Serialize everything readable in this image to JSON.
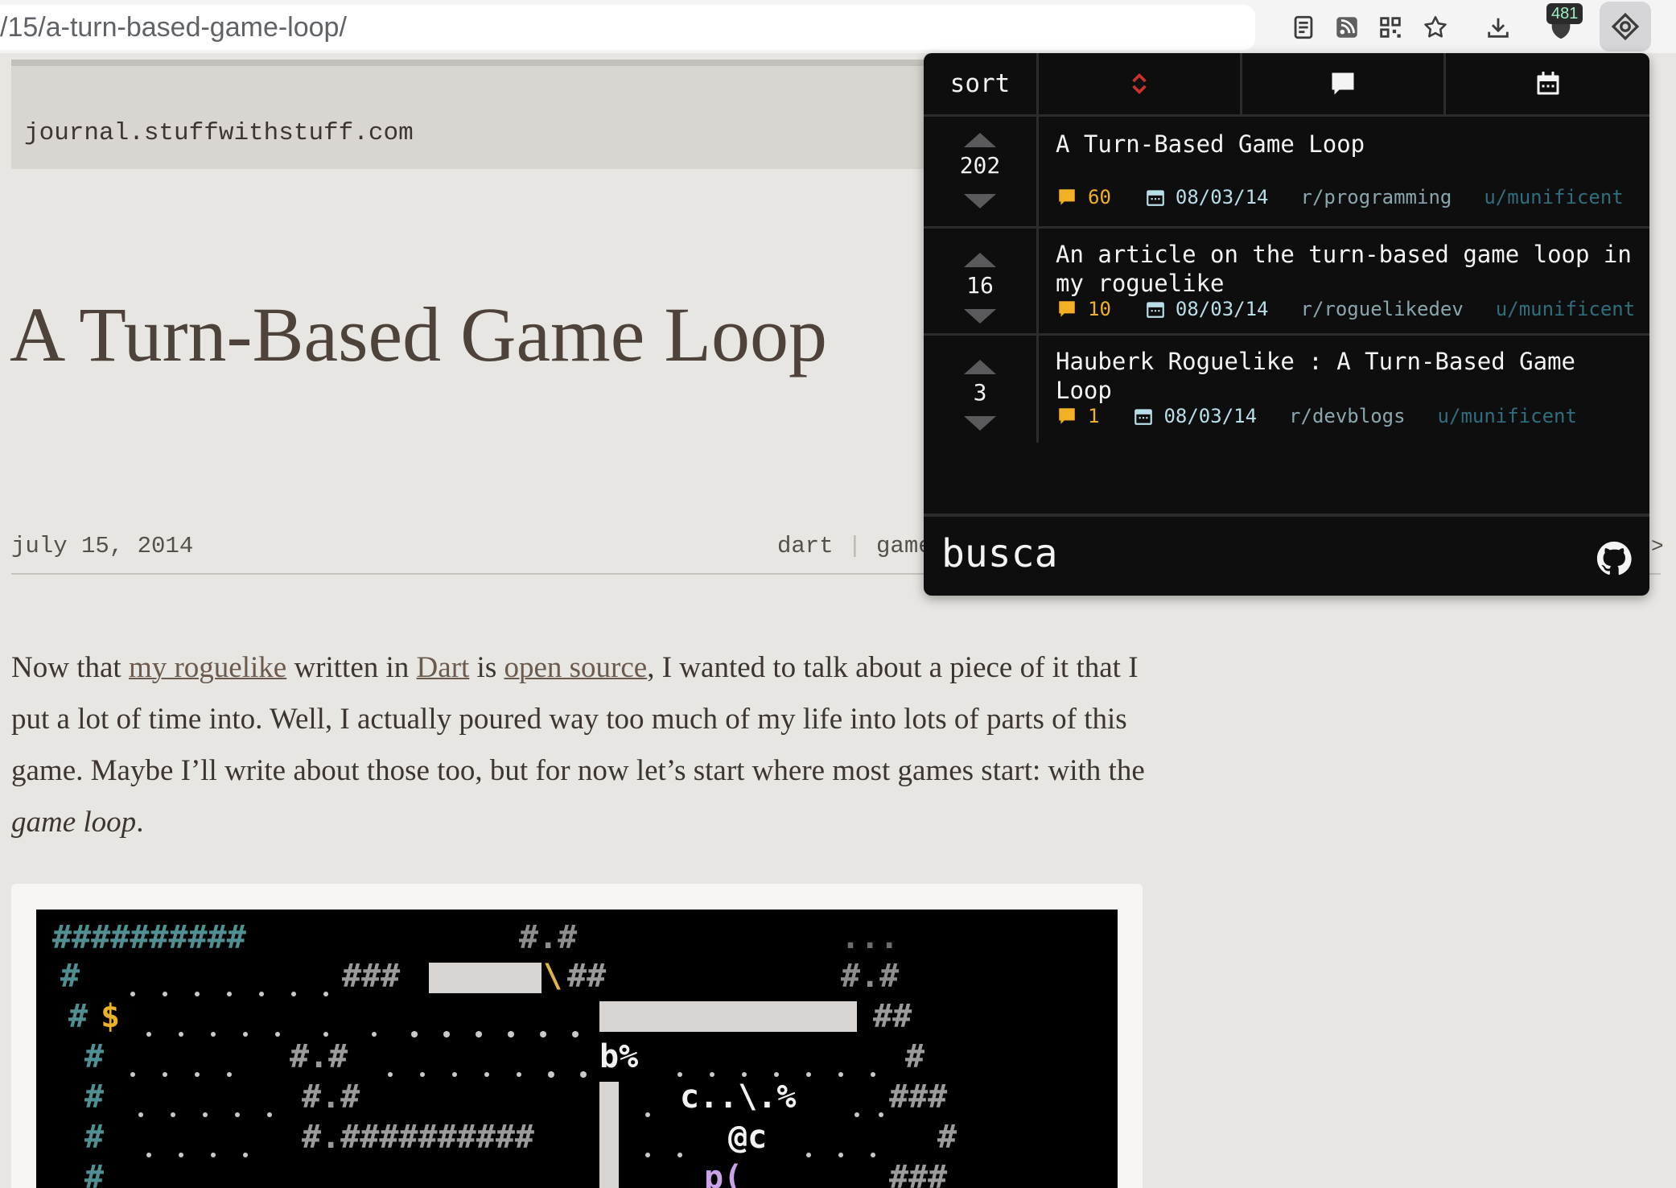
{
  "browser": {
    "url": "/15/a-turn-based-game-loop/",
    "extension_badge": "481"
  },
  "page": {
    "site": "journal.stuffwithstuff.com",
    "title": "A Turn-Based Game Loop",
    "date": "july 15, 2014",
    "tags": [
      "dart",
      "game"
    ],
    "intro": {
      "t1": "Now that ",
      "link1": "my roguelike",
      "t2": " written in ",
      "link2": "Dart",
      "t3": " is ",
      "link3": "open source",
      "t4": ", I wanted to talk about a piece of it that I put a lot of time into. Well, I actually poured way too much of my life into lots of parts of this game. Maybe I’ll write about those too, but for now let’s start where most games start: with the ",
      "em": "game loop",
      "t5": "."
    }
  },
  "popup": {
    "sort_label": "sort",
    "icons": [
      "sort-arrows-icon",
      "comment-icon",
      "calendar-icon"
    ],
    "results": [
      {
        "score": "202",
        "title": "A Turn-Based Game Loop",
        "comments": "60",
        "date": "08/03/14",
        "subreddit": "r/programming",
        "user": "u/munificent"
      },
      {
        "score": "16",
        "title": "An article on the turn-based game loop in my roguelike",
        "comments": "10",
        "date": "08/03/14",
        "subreddit": "r/roguelikedev",
        "user": "u/munificent"
      },
      {
        "score": "3",
        "title": "Hauberk Roguelike : A Turn-Based Game Loop",
        "comments": "1",
        "date": "08/03/14",
        "subreddit": "r/devblogs",
        "user": "u/munificent"
      }
    ],
    "brand": "busca"
  },
  "colors": {
    "accent_red": "#c8332b",
    "comment_yellow": "#f3b024",
    "popup_bg": "#0e0e0f"
  }
}
